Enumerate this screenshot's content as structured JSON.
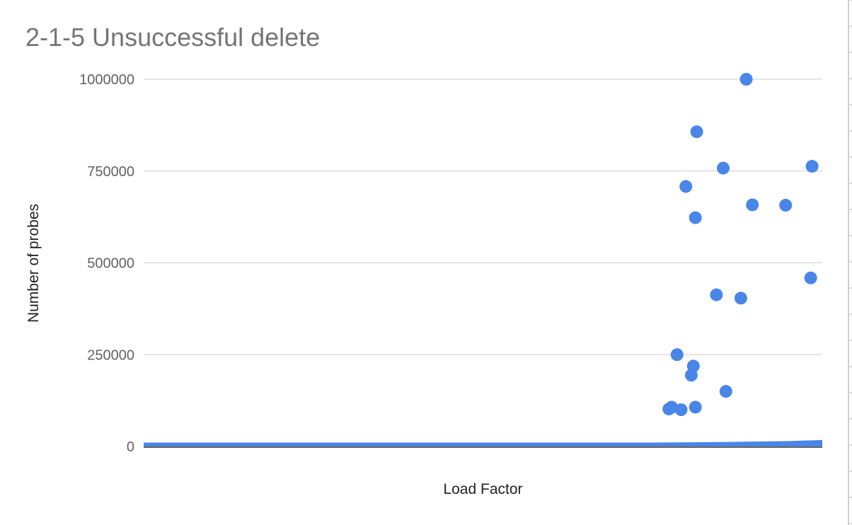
{
  "chart_data": {
    "type": "scatter",
    "title": "2-1-5 Unsuccessful delete",
    "xlabel": "Load Factor",
    "ylabel": "Number of probes",
    "ylim": [
      0,
      1000000
    ],
    "yticks": [
      "0",
      "250000",
      "500000",
      "750000",
      "1000000"
    ],
    "xlim": [
      0,
      1
    ],
    "grid": true,
    "legend": "none",
    "series_color": "#4a86e8",
    "series": [
      {
        "points": [
          {
            "x": 0.888,
            "y": 1000000
          },
          {
            "x": 0.815,
            "y": 857000
          },
          {
            "x": 0.854,
            "y": 758000
          },
          {
            "x": 0.985,
            "y": 763000
          },
          {
            "x": 0.799,
            "y": 708000
          },
          {
            "x": 0.897,
            "y": 658000
          },
          {
            "x": 0.946,
            "y": 657000
          },
          {
            "x": 0.813,
            "y": 623000
          },
          {
            "x": 0.983,
            "y": 459000
          },
          {
            "x": 0.844,
            "y": 413000
          },
          {
            "x": 0.88,
            "y": 404000
          },
          {
            "x": 0.786,
            "y": 250000
          },
          {
            "x": 0.81,
            "y": 219000
          },
          {
            "x": 0.807,
            "y": 194000
          },
          {
            "x": 0.858,
            "y": 150000
          },
          {
            "x": 0.778,
            "y": 107000
          },
          {
            "x": 0.774,
            "y": 102000
          },
          {
            "x": 0.792,
            "y": 100000
          },
          {
            "x": 0.813,
            "y": 107000
          }
        ]
      }
    ],
    "baseline_band": [
      {
        "x": 0.0,
        "y": 1000
      },
      {
        "x": 0.75,
        "y": 1000
      },
      {
        "x": 0.85,
        "y": 2500
      },
      {
        "x": 0.95,
        "y": 5000
      },
      {
        "x": 1.0,
        "y": 8000
      }
    ]
  }
}
